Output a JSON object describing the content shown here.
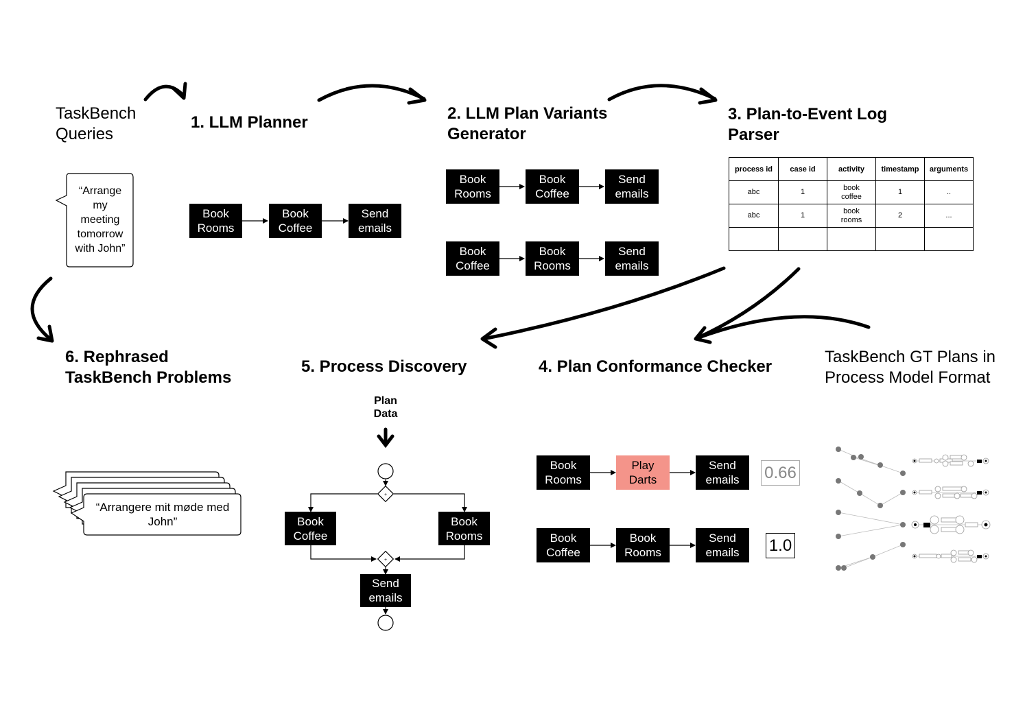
{
  "headings": {
    "taskbench_queries": "TaskBench\nQueries",
    "llm_planner": "1. LLM Planner",
    "plan_variants": "2. LLM Plan Variants\nGenerator",
    "event_log_parser": "3. Plan-to-Event Log\nParser",
    "conformance_checker": "4. Plan Conformance Checker",
    "process_discovery": "5. Process Discovery",
    "rephrased_problems": "6. Rephrased\nTaskBench Problems",
    "gt_plans": "TaskBench GT Plans in\nProcess Model Format"
  },
  "query_bubble": "“Arrange\nmy\nmeeting\ntomorrow\nwith John”",
  "rephrased_bubble": "“Arrangere mit møde med\nJohn”",
  "planner_plan": [
    "Book\nRooms",
    "Book\nCoffee",
    "Send\nemails"
  ],
  "plan_variants": [
    [
      "Book\nRooms",
      "Book\nCoffee",
      "Send\nemails"
    ],
    [
      "Book\nCoffee",
      "Book\nRooms",
      "Send\nemails"
    ]
  ],
  "event_log": {
    "columns": [
      "process id",
      "case id",
      "activity",
      "timestamp",
      "arguments"
    ],
    "rows": [
      [
        "abc",
        "1",
        "book\ncoffee",
        "1",
        ".."
      ],
      [
        "abc",
        "1",
        "book\nrooms",
        "2",
        "..."
      ],
      [
        "",
        "",
        "",
        "",
        ""
      ]
    ]
  },
  "conformance": [
    {
      "steps": [
        "Book\nRooms",
        "Play\nDarts",
        "Send\nemails"
      ],
      "highlight_index": 1,
      "score": "0.66"
    },
    {
      "steps": [
        "Book\nCoffee",
        "Book\nRooms",
        "Send\nemails"
      ],
      "highlight_index": -1,
      "score": "1.0"
    }
  ],
  "discovery": {
    "input_label": "Plan\nData",
    "branch_left": "Book\nCoffee",
    "branch_right": "Book\nRooms",
    "final_step": "Send\nemails",
    "gateway_symbol": "+"
  },
  "colors": {
    "highlight": "#f4948a",
    "score_low": "#888888"
  }
}
